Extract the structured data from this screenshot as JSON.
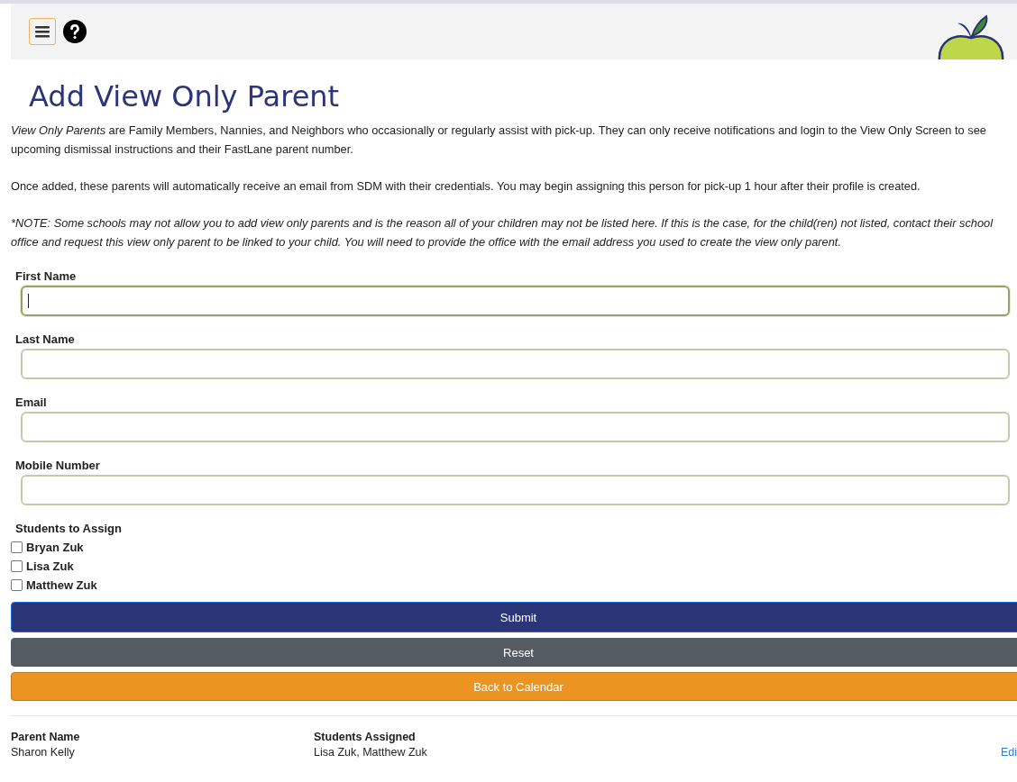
{
  "header": {
    "menu_button": {
      "selected": true
    }
  },
  "title": "Add View Only Parent",
  "paragraphs": [
    {
      "kind": "plain",
      "text": "*View Only Parents* are Family Members, Nannies, and Neighbors who occasionally or regularly assist with pick-up. They can only receive notifications and login to the View Only Screen to see upcoming dismissal instructions and their FastLane parent number."
    },
    {
      "kind": "plain",
      "text": "Once added, these parents will automatically receive an email from SDM with their credentials. You may begin assigning this person for pick-up 1 hour after their profile is created."
    },
    {
      "kind": "note",
      "text": "*NOTE: Some schools may not allow you to add view only parents and is the reason all of your children may not be listed here. If this is the case, for the child(ren) not listed, contact their school office and request this view only parent to be linked to your child. You will need to provide the office with the email address you used to create the view only parent."
    }
  ],
  "fields": [
    {
      "label": "First Name",
      "focused": true
    },
    {
      "label": "Last Name",
      "focused": false
    },
    {
      "label": "Email",
      "focused": false
    },
    {
      "label": "Mobile Number",
      "focused": false
    }
  ],
  "students": {
    "label": "Students to Assign",
    "items": [
      {
        "name": "Bryan Zuk",
        "checked": false
      },
      {
        "name": "Lisa Zuk",
        "checked": false
      },
      {
        "name": "Matthew Zuk",
        "checked": false
      }
    ]
  },
  "buttons": [
    {
      "kind": "primary",
      "label": "Submit"
    },
    {
      "kind": "secondary",
      "label": "Reset"
    },
    {
      "kind": "warning",
      "label": "Back to Calendar"
    }
  ],
  "table": {
    "columns": [
      "Parent Name",
      "Students Assigned"
    ],
    "rows": [
      {
        "cells": [
          "Sharon Kelly",
          "Lisa Zuk, Matthew Zuk"
        ],
        "action": "Edi"
      }
    ]
  }
}
